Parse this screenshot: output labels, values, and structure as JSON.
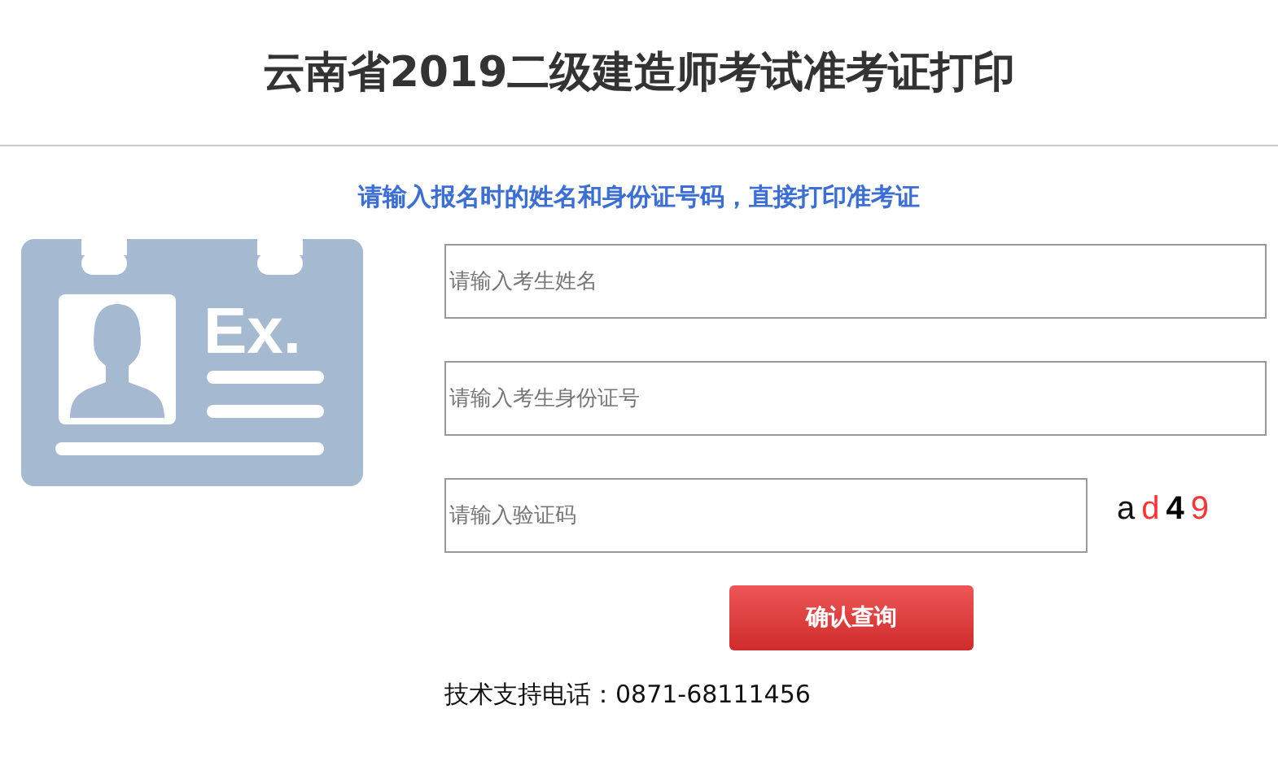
{
  "title": "云南省2019二级建造师考试准考证打印",
  "subtitle": "请输入报名时的姓名和身份证号码，直接打印准考证",
  "card_text": "Ex.",
  "fields": [
    {
      "placeholder": "请输入考生姓名"
    },
    {
      "placeholder": "请输入考生身份证号"
    },
    {
      "placeholder": "请输入验证码"
    }
  ],
  "captcha": [
    {
      "char": "a",
      "color": "#111111"
    },
    {
      "char": "d",
      "color": "#ff3333"
    },
    {
      "char": "4",
      "color": "#000000"
    },
    {
      "char": "9",
      "color": "#ff3333"
    }
  ],
  "submit": "确认查询",
  "support": "技术支持电话：0871-68111456"
}
